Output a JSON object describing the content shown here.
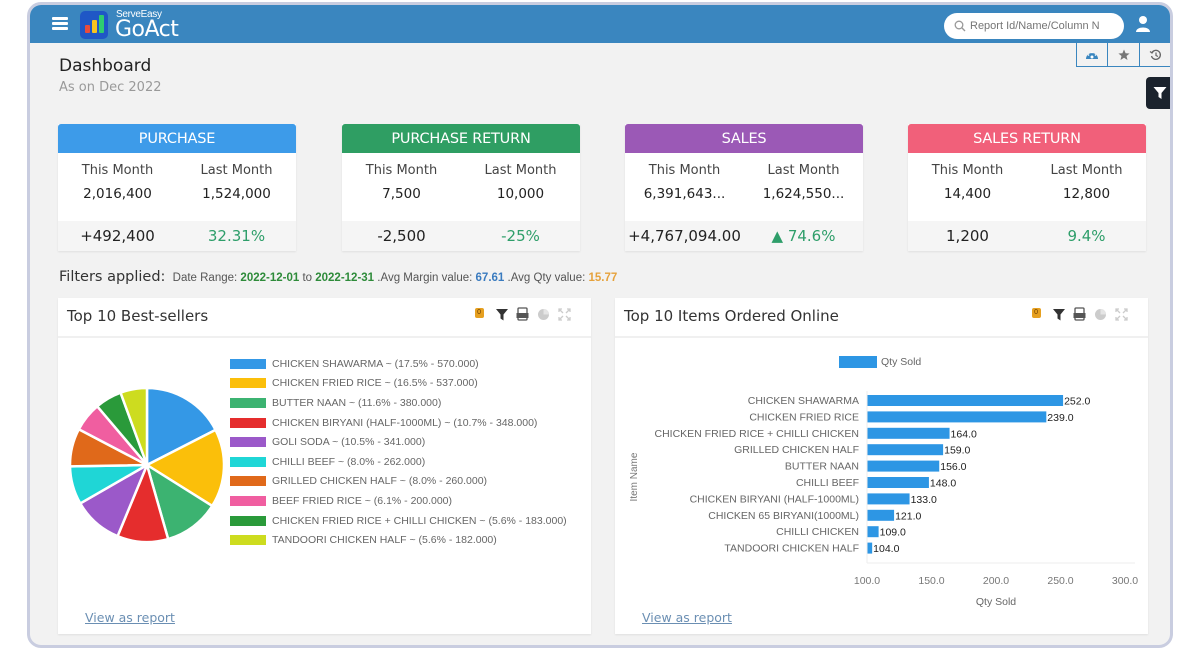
{
  "app": {
    "brand_small": "ServeEasy",
    "brand_big": "GoAct",
    "search_placeholder": "Report Id/Name/Column N",
    "icons": {
      "menu": "hamburger-menu-icon",
      "search": "search-icon",
      "user": "user-icon",
      "dashboard_tab": "speedometer-icon",
      "favorites_tab": "star-icon",
      "history_tab": "history-icon",
      "filter": "filter-icon"
    },
    "colors": {
      "topbar": "#3a86bf",
      "accent_blue": "#2d96e4"
    }
  },
  "page": {
    "title": "Dashboard",
    "subtitle": "As on Dec 2022"
  },
  "kpis": [
    {
      "title": "PURCHASE",
      "color": "#3d9be9",
      "this_label": "This Month",
      "last_label": "Last Month",
      "this_value": "2,016,400",
      "last_value": "1,524,000",
      "delta": "+492,400",
      "pct": "32.31%"
    },
    {
      "title": "PURCHASE RETURN",
      "color": "#2f9e63",
      "this_label": "This Month",
      "last_label": "Last Month",
      "this_value": "7,500",
      "last_value": "10,000",
      "delta": "-2,500",
      "pct": "-25%"
    },
    {
      "title": "SALES",
      "color": "#9b59b6",
      "this_label": "This Month",
      "last_label": "Last Month",
      "this_value": "6,391,643...",
      "last_value": "1,624,550...",
      "delta": "+4,767,094.00",
      "pct": "▲ 74.6%"
    },
    {
      "title": "SALES RETURN",
      "color": "#f1607a",
      "this_label": "This Month",
      "last_label": "Last Month",
      "this_value": "14,400",
      "last_value": "12,800",
      "delta": "1,200",
      "pct": "9.4%"
    }
  ],
  "filters": {
    "label": "Filters applied:",
    "date_range_label": "Date Range:",
    "date_from": "2022-12-01",
    "to": "to",
    "date_to": "2022-12-31",
    "avg_margin_label": ".Avg Margin value:",
    "avg_margin_value": "67.61",
    "avg_qty_label": ".Avg Qty value:",
    "avg_qty_value": "15.77"
  },
  "panels": [
    {
      "title": "Top 10 Best-sellers",
      "filter_badge": "0",
      "view_report": "View as report"
    },
    {
      "title": "Top 10 Items Ordered Online",
      "filter_badge": "0",
      "view_report": "View as report"
    }
  ],
  "chart_data": [
    {
      "type": "pie",
      "title": "Top 10 Best-sellers",
      "legend_position": "right",
      "slices": [
        {
          "label": "CHICKEN SHAWARMA",
          "percent": 17.5,
          "value": 570.0,
          "color": "#3498e6",
          "legend": "CHICKEN SHAWARMA ~ (17.5% - 570.000)"
        },
        {
          "label": "CHICKEN FRIED RICE",
          "percent": 16.5,
          "value": 537.0,
          "color": "#fbbf0a",
          "legend": "CHICKEN FRIED RICE ~ (16.5% - 537.000)"
        },
        {
          "label": "BUTTER NAAN",
          "percent": 11.6,
          "value": 380.0,
          "color": "#3cb371",
          "legend": "BUTTER NAAN ~ (11.6% - 380.000)"
        },
        {
          "label": "CHICKEN BIRYANI (HALF-1000ML)",
          "percent": 10.7,
          "value": 348.0,
          "color": "#e52d2d",
          "legend": "CHICKEN BIRYANI (HALF-1000ML) ~ (10.7% - 348.000)"
        },
        {
          "label": "GOLI SODA",
          "percent": 10.5,
          "value": 341.0,
          "color": "#9b59c9",
          "legend": "GOLI SODA ~ (10.5% - 341.000)"
        },
        {
          "label": "CHILLI BEEF",
          "percent": 8.0,
          "value": 262.0,
          "color": "#1fd6d6",
          "legend": "CHILLI BEEF ~ (8.0% - 262.000)"
        },
        {
          "label": "GRILLED CHICKEN HALF",
          "percent": 8.0,
          "value": 260.0,
          "color": "#e0691a",
          "legend": "GRILLED CHICKEN HALF ~ (8.0% - 260.000)"
        },
        {
          "label": "BEEF FRIED RICE",
          "percent": 6.1,
          "value": 200.0,
          "color": "#f05ea0",
          "legend": "BEEF FRIED RICE ~ (6.1% - 200.000)"
        },
        {
          "label": "CHICKEN FRIED RICE + CHILLI CHICKEN",
          "percent": 5.6,
          "value": 183.0,
          "color": "#2a9a3a",
          "legend": "CHICKEN FRIED RICE + CHILLI CHICKEN ~ (5.6% - 183.000)"
        },
        {
          "label": "TANDOORI CHICKEN HALF",
          "percent": 5.6,
          "value": 182.0,
          "color": "#cddc1f",
          "legend": "TANDOORI CHICKEN HALF ~ (5.6% - 182.000)"
        }
      ]
    },
    {
      "type": "bar",
      "orientation": "horizontal",
      "title": "Top 10 Items Ordered Online",
      "legend_position": "top",
      "series": [
        {
          "name": "Qty Sold",
          "color": "#2d96e4",
          "values": [
            252.0,
            239.0,
            164.0,
            159.0,
            156.0,
            148.0,
            133.0,
            121.0,
            109.0,
            104.0
          ]
        }
      ],
      "categories": [
        "CHICKEN SHAWARMA",
        "CHICKEN FRIED RICE",
        "CHICKEN FRIED RICE + CHILLI CHICKEN",
        "GRILLED CHICKEN HALF",
        "BUTTER NAAN",
        "CHILLI BEEF",
        "CHICKEN BIRYANI (HALF-1000ML)",
        "CHICKEN 65 BIRYANI(1000ML)",
        "CHILLI CHICKEN",
        "TANDOORI CHICKEN HALF"
      ],
      "data_labels": [
        "252.0",
        "239.0",
        "164.0",
        "159.0",
        "156.0",
        "148.0",
        "133.0",
        "121.0",
        "109.0",
        "104.0"
      ],
      "xlabel": "Qty Sold",
      "ylabel": "Item Name",
      "xlim": [
        100,
        300
      ],
      "xticks": [
        "100.0",
        "150.0",
        "200.0",
        "250.0",
        "300.0"
      ],
      "grid": false
    }
  ]
}
